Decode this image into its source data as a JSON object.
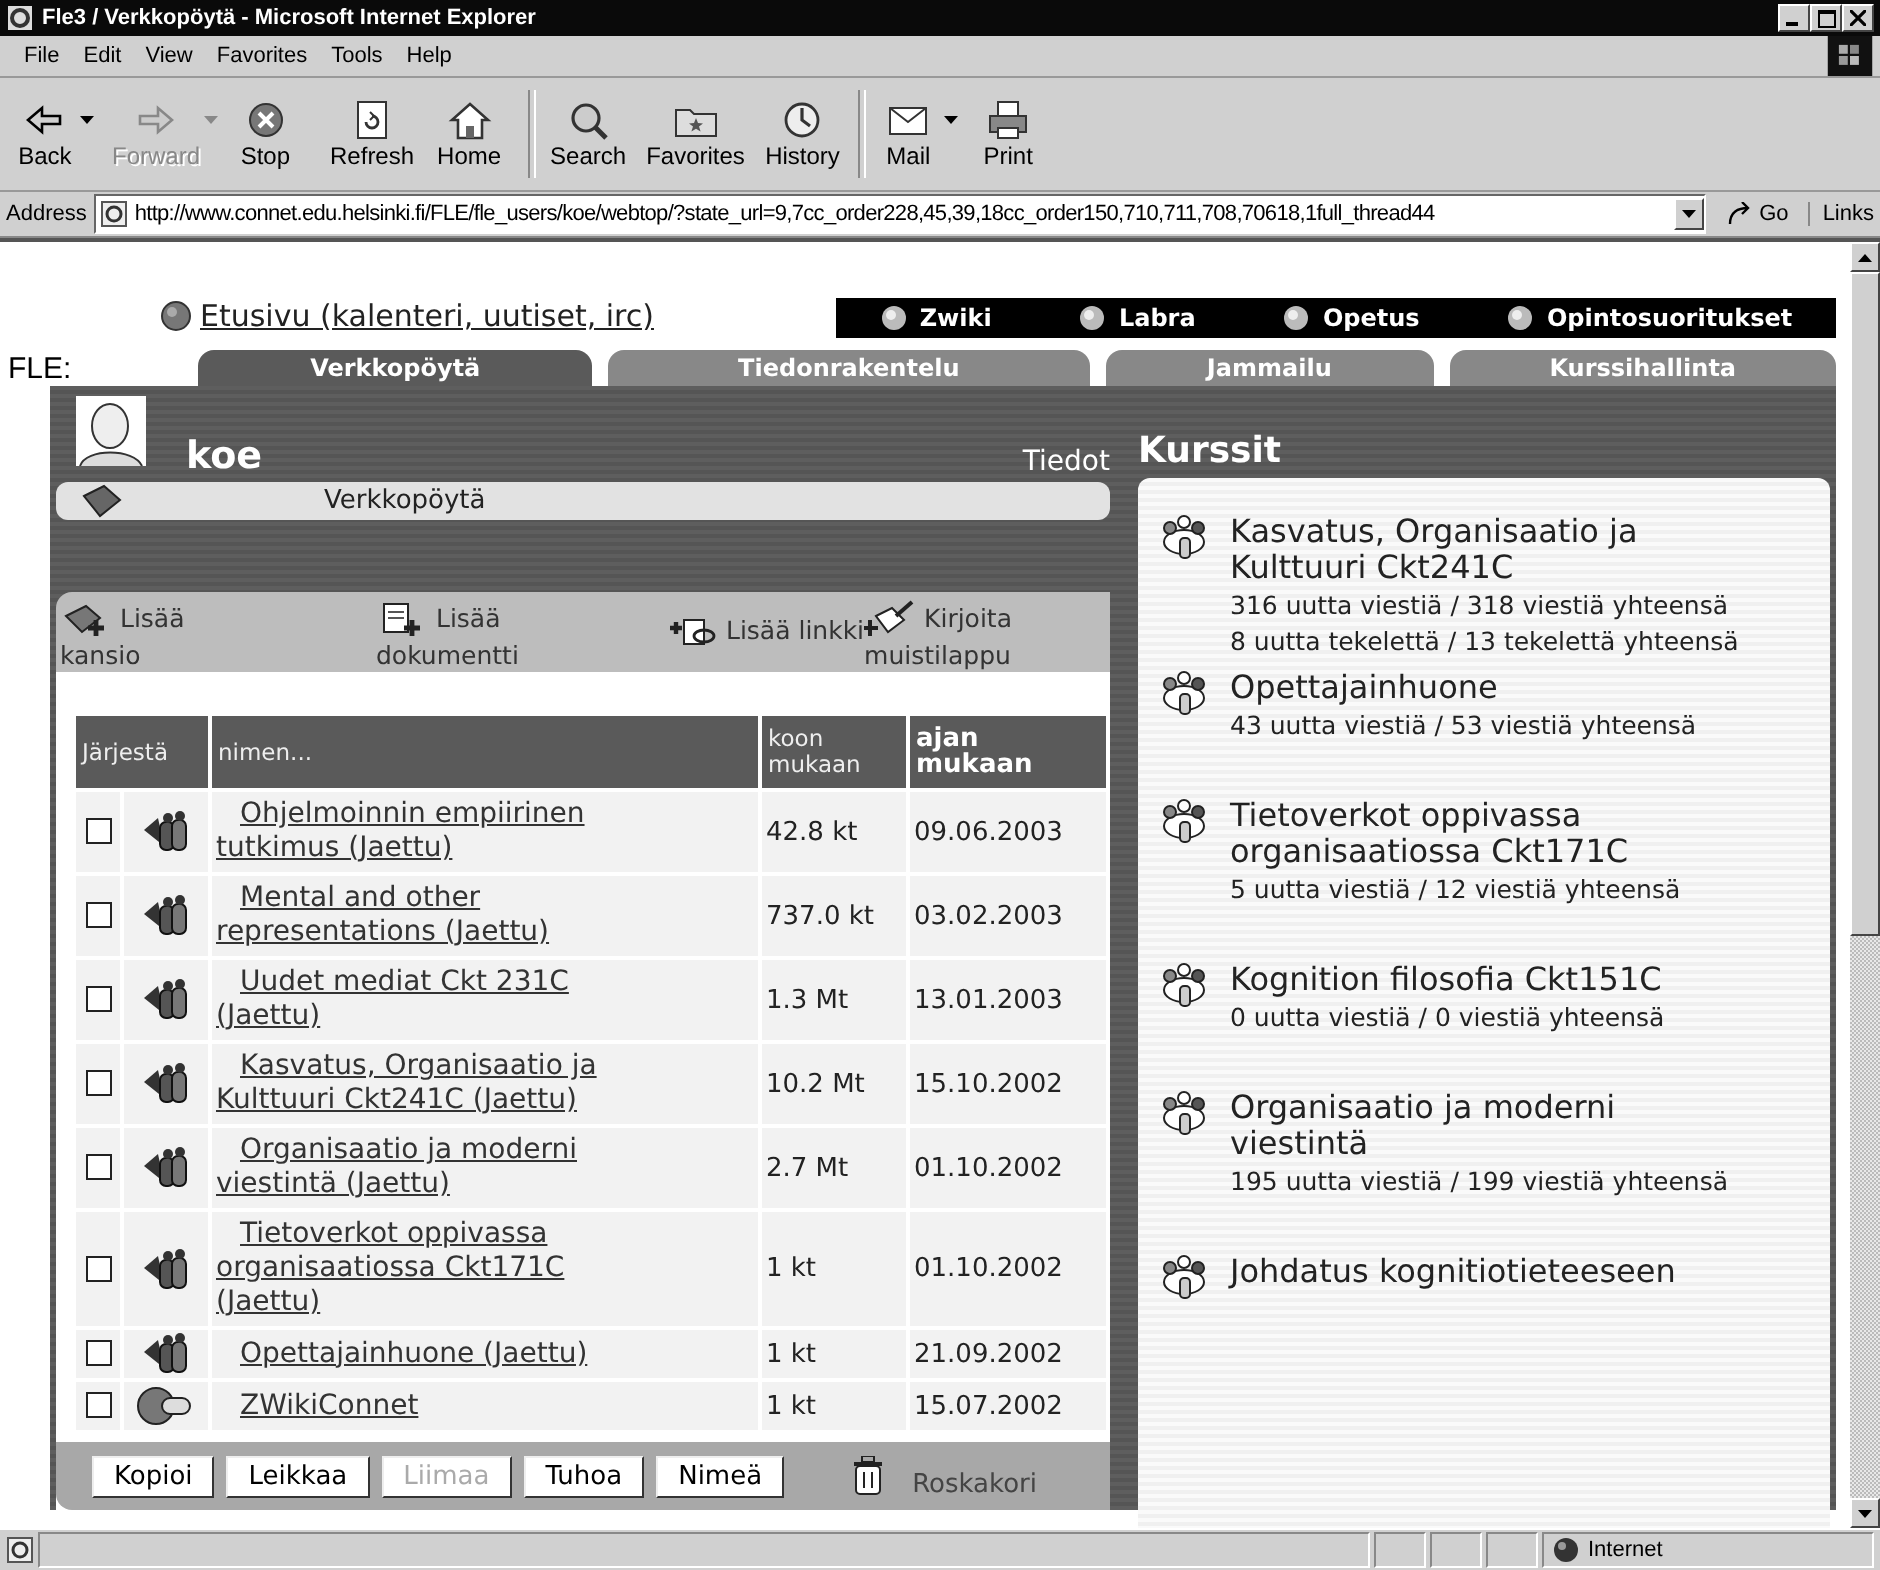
{
  "window": {
    "title": "Fle3 / Verkkopöytä - Microsoft Internet Explorer"
  },
  "menu": [
    "File",
    "Edit",
    "View",
    "Favorites",
    "Tools",
    "Help"
  ],
  "toolbar": [
    {
      "kind": "back",
      "label": "Back",
      "disabled": false,
      "dropdown": true
    },
    {
      "kind": "forward",
      "label": "Forward",
      "disabled": true,
      "dropdown": true
    },
    {
      "kind": "stop",
      "label": "Stop",
      "disabled": false,
      "dropdown": false
    },
    {
      "kind": "refresh",
      "label": "Refresh",
      "disabled": false,
      "dropdown": false
    },
    {
      "kind": "home",
      "label": "Home",
      "disabled": false,
      "dropdown": false
    },
    {
      "kind": "search",
      "label": "Search",
      "disabled": false,
      "dropdown": false
    },
    {
      "kind": "favorites",
      "label": "Favorites",
      "disabled": false,
      "dropdown": false
    },
    {
      "kind": "history",
      "label": "History",
      "disabled": false,
      "dropdown": false
    },
    {
      "kind": "mail",
      "label": "Mail",
      "disabled": false,
      "dropdown": true
    },
    {
      "kind": "print",
      "label": "Print",
      "disabled": false,
      "dropdown": false
    }
  ],
  "address": {
    "label": "Address",
    "value": "http://www.connet.edu.helsinki.fi/FLE/fle_users/koe/webtop/?state_url=9,7cc_order228,45,39,18cc_order150,710,711,708,70618,1full_thread44",
    "go": "Go",
    "links": "Links"
  },
  "page": {
    "home_link": "Etusivu (kalenteri, uutiset, irc)",
    "nav": [
      "Zwiki",
      "Labra",
      "Opetus",
      "Opintosuoritukset"
    ],
    "fle_label": "FLE:",
    "tabs": [
      {
        "label": "Verkkopöytä",
        "selected": true
      },
      {
        "label": "Tiedonrakentelu",
        "selected": false
      },
      {
        "label": "Jammailu",
        "selected": false
      },
      {
        "label": "Kurssihallinta",
        "selected": false
      }
    ],
    "user": {
      "name": "koe",
      "info_link": "Tiedot"
    },
    "breadcrumb": "Verkkopöytä",
    "actions": [
      {
        "kind": "folder",
        "label": "Lisää kansio"
      },
      {
        "kind": "document",
        "label": "Lisää dokumentti"
      },
      {
        "kind": "link",
        "label": "Lisää linkki"
      },
      {
        "kind": "memo",
        "label": "Kirjoita muistilappu"
      }
    ],
    "table": {
      "columns": [
        {
          "label": "Järjestä",
          "selected": false
        },
        {
          "label": "nimen...",
          "selected": false
        },
        {
          "label": "koon mukaan",
          "selected": false
        },
        {
          "label": "ajan mukaan",
          "selected": true
        }
      ],
      "rows": [
        {
          "kind": "shared",
          "checked": false,
          "name": "Ohjelmoinnin empiirinen tutkimus (Jaettu)",
          "size": "42.8 kt",
          "date": "09.06.2003"
        },
        {
          "kind": "shared",
          "checked": false,
          "name": "Mental and other representations (Jaettu)",
          "size": "737.0 kt",
          "date": "03.02.2003"
        },
        {
          "kind": "shared",
          "checked": false,
          "name": "Uudet mediat Ckt 231C (Jaettu)",
          "size": "1.3 Mt",
          "date": "13.01.2003"
        },
        {
          "kind": "shared",
          "checked": false,
          "name": "Kasvatus, Organisaatio ja Kulttuuri Ckt241C (Jaettu)",
          "size": "10.2 Mt",
          "date": "15.10.2002"
        },
        {
          "kind": "shared",
          "checked": false,
          "name": "Organisaatio ja moderni viestintä (Jaettu)",
          "size": "2.7 Mt",
          "date": "01.10.2002"
        },
        {
          "kind": "shared",
          "checked": false,
          "name": "Tietoverkot oppivassa organisaatiossa Ckt171C (Jaettu)",
          "size": "1 kt",
          "date": "01.10.2002"
        },
        {
          "kind": "shared",
          "checked": false,
          "name": "Opettajainhuone (Jaettu)",
          "size": "1 kt",
          "date": "21.09.2002"
        },
        {
          "kind": "weblink",
          "checked": false,
          "name": "ZWikiConnet",
          "size": "1 kt",
          "date": "15.07.2002"
        }
      ]
    },
    "buttons": [
      {
        "label": "Kopioi",
        "disabled": false
      },
      {
        "label": "Leikkaa",
        "disabled": false
      },
      {
        "label": "Liimaa",
        "disabled": true
      },
      {
        "label": "Tuhoa",
        "disabled": false
      },
      {
        "label": "Nimeä",
        "disabled": false
      }
    ],
    "trash": "Roskakori",
    "courses": {
      "title": "Kurssit",
      "items": [
        {
          "title": "Kasvatus, Organisaatio ja Kulttuuri Ckt241C",
          "stats": [
            "316 uutta viestiä / 318 viestiä yhteensä",
            "8 uutta tekelettä / 13 tekelettä yhteensä"
          ]
        },
        {
          "title": "Opettajainhuone",
          "stats": [
            "43 uutta viestiä / 53 viestiä yhteensä"
          ]
        },
        {
          "title": "Tietoverkot oppivassa organisaatiossa Ckt171C",
          "stats": [
            "5 uutta viestiä / 12 viestiä yhteensä"
          ]
        },
        {
          "title": "Kognition filosofia Ckt151C",
          "stats": [
            "0 uutta viestiä / 0 viestiä yhteensä"
          ]
        },
        {
          "title": "Organisaatio ja moderni viestintä",
          "stats": [
            "195 uutta viestiä / 199 viestiä yhteensä"
          ]
        },
        {
          "title": "Johdatus kognitiotieteeseen"
        }
      ]
    }
  },
  "status_bar": {
    "zone": "Internet"
  }
}
